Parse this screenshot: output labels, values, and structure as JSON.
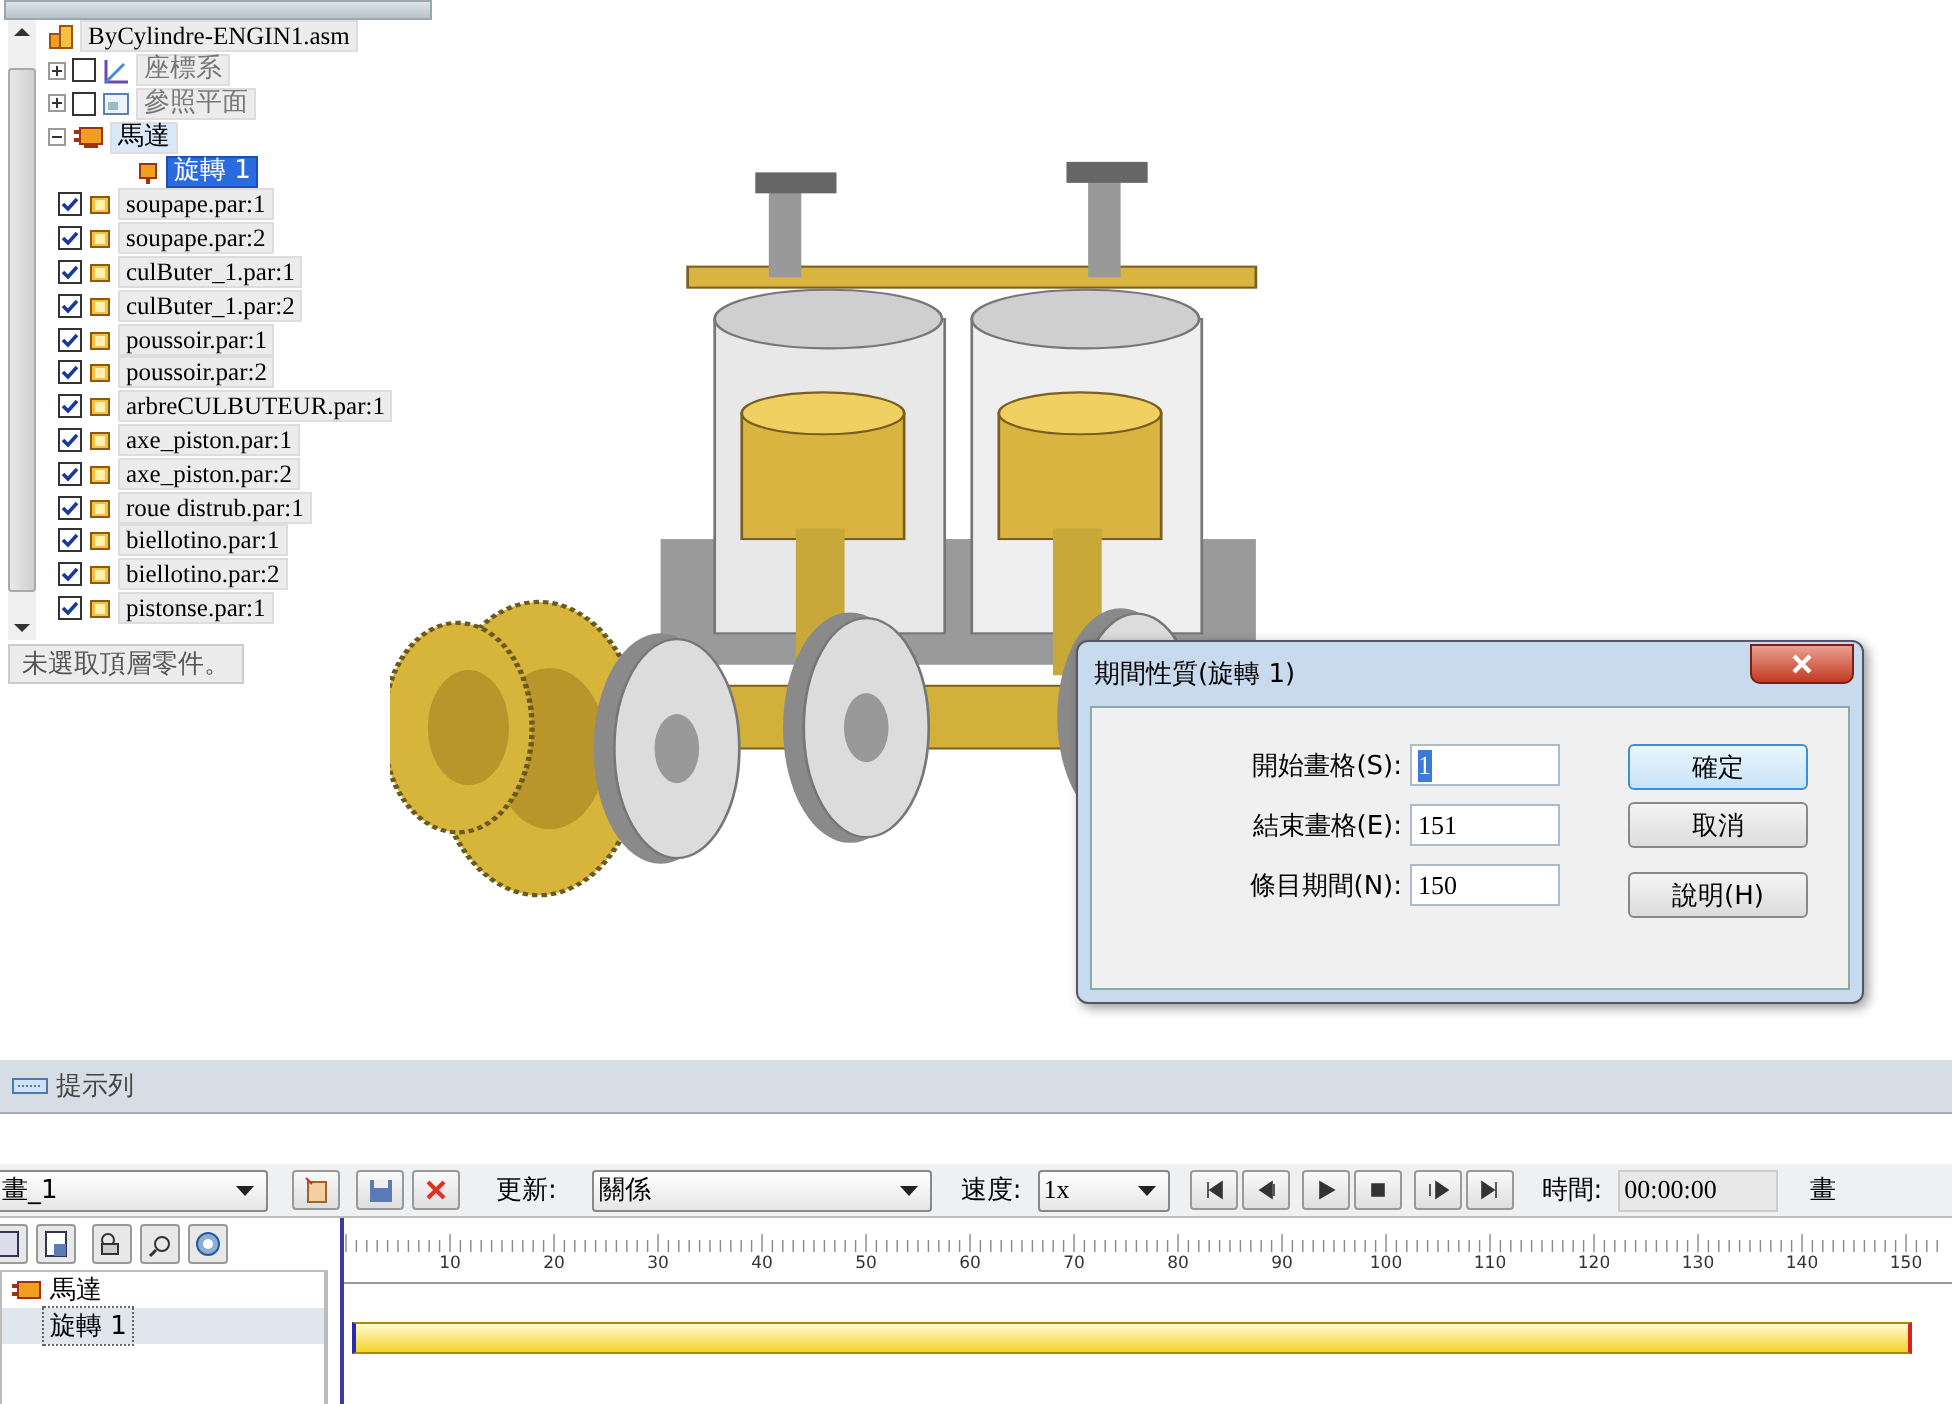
{
  "tree": {
    "root": "ByCylindre-ENGIN1.asm",
    "items": [
      {
        "kind": "coordinate",
        "label": "座標系",
        "checked": false,
        "expanded": false
      },
      {
        "kind": "plane",
        "label": "參照平面",
        "checked": false,
        "expanded": false
      },
      {
        "kind": "motor",
        "label": "馬達",
        "expanded": true,
        "children": [
          {
            "label": "旋轉 1",
            "selected": true
          }
        ]
      },
      {
        "kind": "part",
        "label": "soupape.par:1",
        "checked": true
      },
      {
        "kind": "part",
        "label": "soupape.par:2",
        "checked": true
      },
      {
        "kind": "part",
        "label": "culButer_1.par:1",
        "checked": true
      },
      {
        "kind": "part",
        "label": "culButer_1.par:2",
        "checked": true
      },
      {
        "kind": "part",
        "label": "poussoir.par:1",
        "checked": true
      },
      {
        "kind": "part",
        "label": "poussoir.par:2",
        "checked": true
      },
      {
        "kind": "part",
        "label": "arbreCULBUTEUR.par:1",
        "checked": true
      },
      {
        "kind": "part",
        "label": "axe_piston.par:1",
        "checked": true
      },
      {
        "kind": "part",
        "label": "axe_piston.par:2",
        "checked": true
      },
      {
        "kind": "part",
        "label": "roue distrub.par:1",
        "checked": true
      },
      {
        "kind": "part",
        "label": "biellotino.par:1",
        "checked": true
      },
      {
        "kind": "part",
        "label": "biellotino.par:2",
        "checked": true
      },
      {
        "kind": "part",
        "label": "pistonse.par:1",
        "checked": true
      }
    ],
    "status": "未選取頂層零件。"
  },
  "dialog": {
    "title": "期間性質(旋轉 1)",
    "fields": [
      {
        "label": "開始畫格(S):",
        "value": "1",
        "selected": true
      },
      {
        "label": "結束畫格(E):",
        "value": "151",
        "selected": false
      },
      {
        "label": "條目期間(N):",
        "value": "150",
        "selected": false
      }
    ],
    "buttons": [
      {
        "label": "確定",
        "default": true
      },
      {
        "label": "取消",
        "default": false
      },
      {
        "label": "說明(H)",
        "default": false
      }
    ]
  },
  "prompt_bar": {
    "title": "提示列"
  },
  "toolbar": {
    "animation": "畫_1",
    "update_label": "更新:",
    "update_value": "關係",
    "speed_label": "速度:",
    "speed_value": "1x",
    "time_label": "時間:",
    "time_value": "00:00:00",
    "frame_label": "畫"
  },
  "timeline": {
    "tree": [
      {
        "label": "馬達",
        "children": [
          {
            "label": "旋轉 1",
            "selected": true
          }
        ]
      }
    ],
    "ticks": [
      "10",
      "20",
      "30",
      "40",
      "50",
      "60",
      "70",
      "80",
      "90",
      "100",
      "110",
      "120",
      "130",
      "140",
      "150"
    ]
  }
}
